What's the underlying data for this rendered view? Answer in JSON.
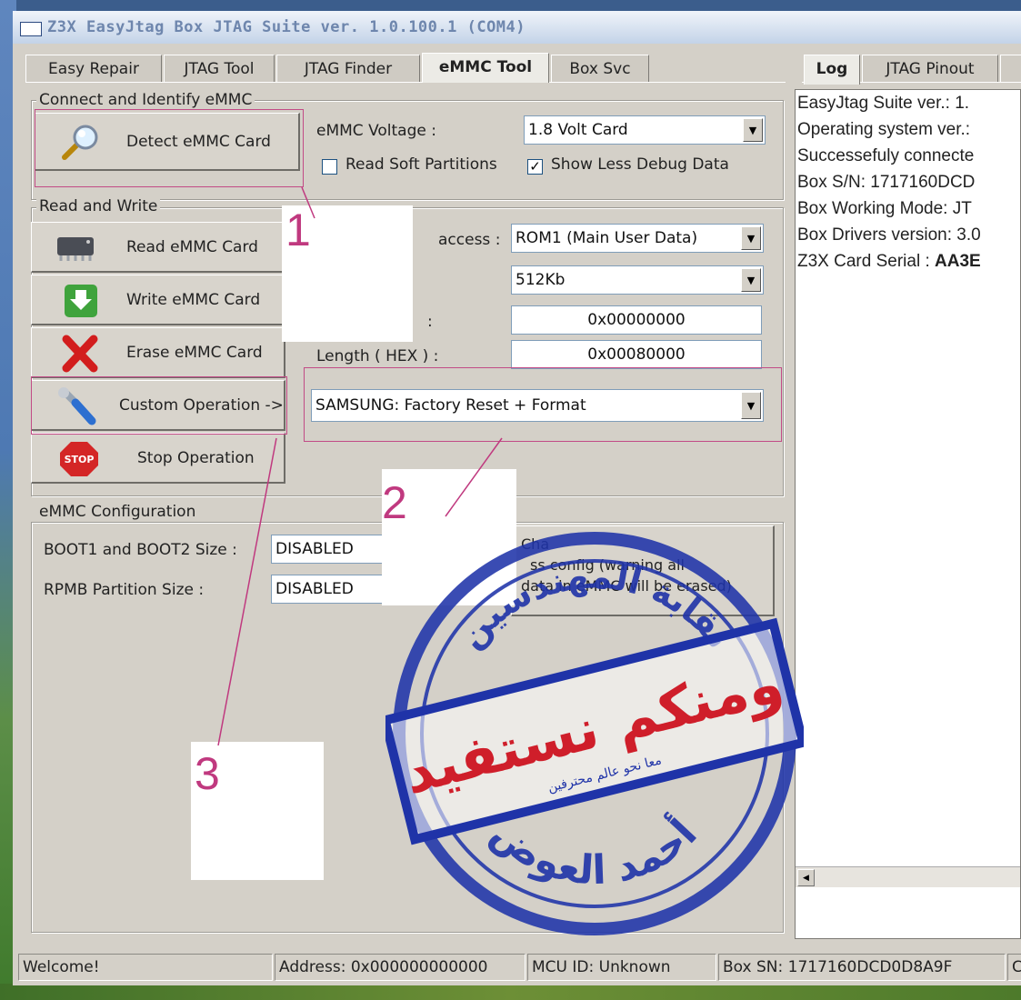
{
  "window": {
    "title": "Z3X EasyJtag Box JTAG Suite ver. 1.0.100.1 (COM4)"
  },
  "tabs": [
    "Easy Repair",
    "JTAG Tool",
    "JTAG Finder",
    "eMMC Tool",
    "Box Svc"
  ],
  "active_tab": "eMMC Tool",
  "right_tabs": [
    "Log",
    "JTAG Pinout"
  ],
  "connect_group": {
    "label": "Connect and Identify eMMC",
    "detect_button": "Detect eMMC Card",
    "voltage_label": "eMMC Voltage :",
    "voltage_value": "1.8 Volt Card",
    "read_soft_partitions": "Read Soft Partitions",
    "read_soft_checked": false,
    "show_less_debug": "Show Less Debug Data",
    "show_less_checked": true
  },
  "rw_group": {
    "label": "Read and Write",
    "buttons": [
      "Read eMMC Card",
      "Write eMMC Card",
      "Erase eMMC Card",
      "Custom Operation ->",
      "Stop Operation"
    ],
    "access_label": "access :",
    "partition_value": "ROM1 (Main User Data)",
    "size_value": "512Kb",
    "start_colon": ":",
    "start_value": "0x00000000",
    "length_label": "Length ( HEX ) :",
    "length_value": "0x00080000",
    "custom_op_value": "SAMSUNG: Factory Reset + Format"
  },
  "config_group": {
    "label": "eMMC Configuration",
    "boot_label": "BOOT1 and BOOT2 Size :",
    "boot_value": "DISABLED",
    "rpmb_label": "RPMB Partition Size :",
    "rpmb_value": "DISABLED",
    "change_button_lines": [
      "Cha",
      "ss config (warning all",
      "data in eMMC will be erased)"
    ]
  },
  "log": {
    "lines": [
      "EasyJtag Suite ver.: 1.",
      "Operating system ver.:",
      "Successefuly connecte",
      "Box S/N: 1717160DCD",
      "Box Working Mode: JT",
      "Box Drivers version: 3.0"
    ],
    "serial_label": "Z3X Card Serial : ",
    "serial_value": "AA3E"
  },
  "status_bar": [
    "Welcome!",
    "Address: 0x000000000000",
    "MCU ID: Unknown",
    "Box SN: 1717160DCD0D8A9F",
    "C"
  ],
  "annotations": [
    "1",
    "2",
    "3"
  ],
  "stamp": {
    "top_text": "نقابة المهندسين",
    "band_text": "ومنكم نستفيد",
    "band_sub": "معا نحو عالم محترفين",
    "bottom_text": "أحمد العوض"
  },
  "colors": {
    "annotation": "#c0397f",
    "stamp": "#1f33a8",
    "window_bg": "#d4d0c8"
  }
}
